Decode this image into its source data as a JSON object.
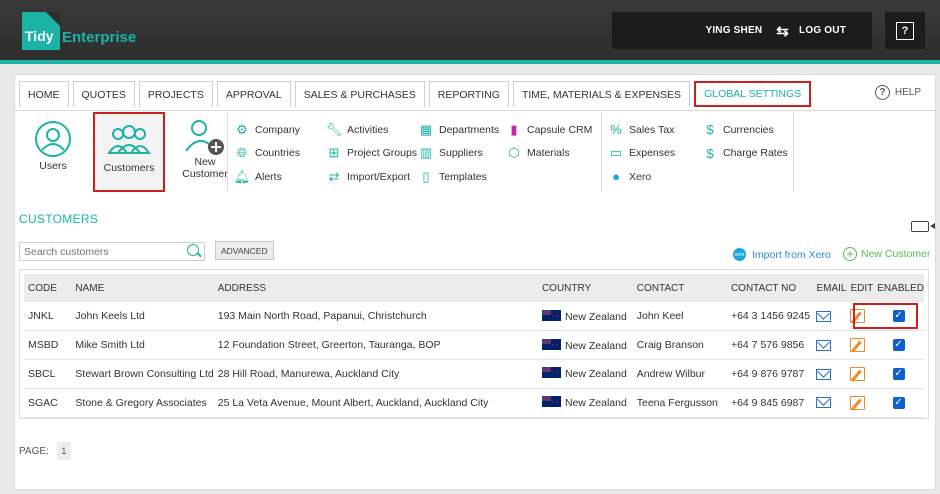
{
  "brand": {
    "logo_word1": "Tidy",
    "logo_word2": "Enterprise",
    "accent": "#1ab3a6"
  },
  "user": {
    "name": "YING SHEN",
    "logout_label": "LOG OUT"
  },
  "help_icon_label": "?",
  "tabs": [
    {
      "label": "HOME"
    },
    {
      "label": "QUOTES"
    },
    {
      "label": "PROJECTS"
    },
    {
      "label": "APPROVAL"
    },
    {
      "label": "SALES & PURCHASES"
    },
    {
      "label": "REPORTING"
    },
    {
      "label": "TIME, MATERIALS & EXPENSES"
    },
    {
      "label": "GLOBAL SETTINGS",
      "active": true
    }
  ],
  "help_label": "HELP",
  "ribbon": {
    "users": "Users",
    "customers": "Customers",
    "new_customer": "New Customer",
    "col1": [
      "Company",
      "Countries",
      "Alerts"
    ],
    "col2": [
      "Activities",
      "Project Groups",
      "Import/Export"
    ],
    "col3": [
      "Departments",
      "Suppliers",
      "Templates"
    ],
    "col4": [
      "Capsule CRM",
      "Materials"
    ],
    "col5": [
      "Sales Tax",
      "Expenses",
      "Xero"
    ],
    "col6": [
      "Currencies",
      "Charge Rates"
    ]
  },
  "section": {
    "title": "CUSTOMERS"
  },
  "search": {
    "placeholder": "Search customers",
    "advanced_label": "ADVANCED"
  },
  "actions": {
    "import_xero": "Import from Xero",
    "new_customer": "New Customer",
    "xero_badge": "xero"
  },
  "table": {
    "headers": [
      "CODE",
      "NAME",
      "ADDRESS",
      "COUNTRY",
      "CONTACT",
      "CONTACT NO",
      "EMAIL",
      "EDIT",
      "ENABLED"
    ],
    "rows": [
      {
        "code": "JNKL",
        "name": "John Keels Ltd",
        "address": "193 Main North Road, Papanui, Christchurch",
        "country": "New Zealand",
        "contact": "John Keel",
        "phone": "+64 3 1456 9245",
        "enabled": true
      },
      {
        "code": "MSBD",
        "name": "Mike Smith Ltd",
        "address": "12 Foundation Street, Greerton, Tauranga, BOP",
        "country": "New Zealand",
        "contact": "Craig Branson",
        "phone": "+64 7 576 9856",
        "enabled": true
      },
      {
        "code": "SBCL",
        "name": "Stewart Brown Consulting Ltd",
        "address": "28 Hill Road, Manurewa, Auckland City",
        "country": "New Zealand",
        "contact": "Andrew Wilbur",
        "phone": "+64 9 876 9787",
        "enabled": true
      },
      {
        "code": "SGAC",
        "name": "Stone & Gregory Associates",
        "address": "25 La Veta Avenue, Mount Albert, Auckland, Auckland City",
        "country": "New Zealand",
        "contact": "Teena Fergusson",
        "phone": "+64 9 845 6987",
        "enabled": true
      }
    ]
  },
  "pager": {
    "label": "PAGE:",
    "current": "1"
  }
}
